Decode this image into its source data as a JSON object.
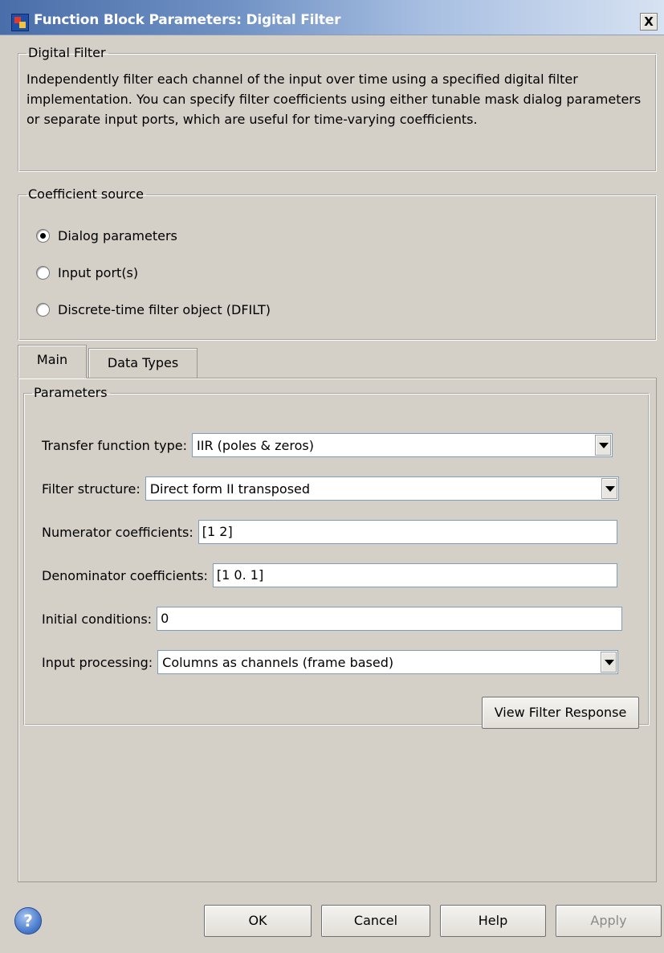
{
  "window": {
    "title": "Function Block Parameters: Digital Filter",
    "close_glyph": "X",
    "icon": "simulink-block-icon"
  },
  "description_group": {
    "title": "Digital Filter",
    "text": "Independently filter each channel of the input over time using a specified digital filter implementation. You can specify filter coefficients using either tunable mask dialog parameters or separate input ports, which are useful for time-varying coefficients."
  },
  "coefficient_source": {
    "title": "Coefficient source",
    "options": [
      {
        "label": "Dialog parameters",
        "checked": true
      },
      {
        "label": "Input port(s)",
        "checked": false
      },
      {
        "label": "Discrete-time filter object (DFILT)",
        "checked": false
      }
    ]
  },
  "tabs": [
    {
      "label": "Main",
      "active": true
    },
    {
      "label": "Data Types",
      "active": false
    }
  ],
  "parameters": {
    "title": "Parameters",
    "transfer_function_type": {
      "label": "Transfer function type:",
      "value": "IIR (poles & zeros)"
    },
    "filter_structure": {
      "label": "Filter structure:",
      "value": "Direct form II transposed"
    },
    "numerator": {
      "label": "Numerator coefficients:",
      "value": "[1 2]"
    },
    "denominator": {
      "label": "Denominator coefficients:",
      "value": "[1 0. 1]"
    },
    "initial_conditions": {
      "label": "Initial conditions:",
      "value": "0"
    },
    "input_processing": {
      "label": "Input processing:",
      "value": "Columns as channels (frame based)"
    },
    "view_filter_response": "View Filter Response"
  },
  "buttons": {
    "help_glyph": "?",
    "ok": "OK",
    "cancel": "Cancel",
    "help": "Help",
    "apply": "Apply"
  }
}
